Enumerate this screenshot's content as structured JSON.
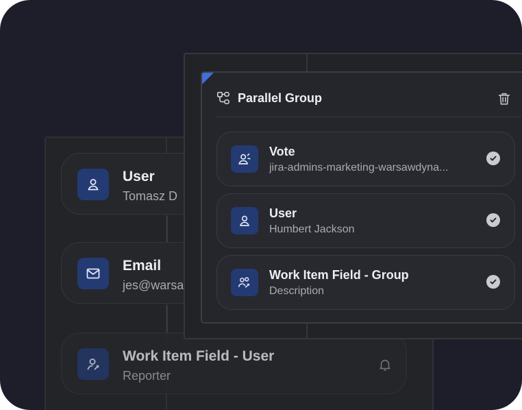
{
  "colors": {
    "background": "#1d1e29",
    "accent": "#3f6fd8",
    "icon_tile": "#243a72",
    "check": "#c8cbd2"
  },
  "back_cards": [
    {
      "title": "User",
      "subtitle": "Tomasz D",
      "icon": "user-icon"
    },
    {
      "title": "Email",
      "subtitle": "jes@warsa",
      "icon": "mail-icon"
    },
    {
      "title": "Work Item Field - User",
      "subtitle": "Reporter",
      "icon": "user-edit-icon",
      "action_icon": "bell-icon"
    }
  ],
  "parallel_group": {
    "title": "Parallel Group",
    "header_icon": "parallel-group-icon",
    "delete_icon": "trash-icon",
    "items": [
      {
        "title": "Vote",
        "subtitle": "jira-admins-marketing-warsawdyna...",
        "icon": "user-vote-icon",
        "status_icon": "check-icon"
      },
      {
        "title": "User",
        "subtitle": "Humbert Jackson",
        "icon": "user-icon",
        "status_icon": "check-icon"
      },
      {
        "title": "Work Item Field - Group",
        "subtitle": "Description",
        "icon": "group-edit-icon",
        "status_icon": "check-icon"
      }
    ]
  }
}
